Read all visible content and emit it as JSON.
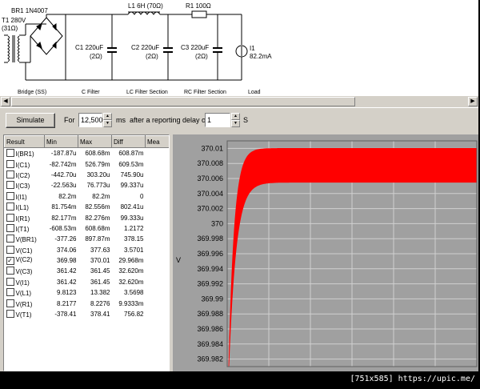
{
  "schematic": {
    "transformer_label": "T1 280V",
    "transformer_res": "(31Ω)",
    "bridge_label": "BR1 1N4007",
    "inductor_label": "L1 6H (70Ω)",
    "resistor_label": "R1 100Ω",
    "c1_label": "C1 220uF",
    "c1_res": "(2Ω)",
    "c2_label": "C2 220uF",
    "c2_res": "(2Ω)",
    "c3_label": "C3 220uF",
    "c3_res": "(2Ω)",
    "load_name": "I1",
    "load_value": "82.2mA",
    "sections": [
      "Bridge (SS)",
      "C Filter",
      "LC Filter Section",
      "RC Filter Section",
      "Load"
    ]
  },
  "toolbar": {
    "simulate_label": "Simulate",
    "for_label": "For",
    "duration_value": "12,500",
    "ms_label": "ms",
    "delay_label": "after a reporting delay of",
    "delay_value": "1",
    "s_label": "S"
  },
  "results": {
    "headers": [
      "Result",
      "Min",
      "Max",
      "Diff",
      "Mea"
    ],
    "rows": [
      {
        "name": "I(BR1)",
        "min": "-187.87u",
        "max": "608.68m",
        "diff": "608.87m",
        "mean": "41.102",
        "checked": false
      },
      {
        "name": "I(C1)",
        "min": "-82.742m",
        "max": "526.79m",
        "diff": "609.53m",
        "mean": "-2.118",
        "checked": false
      },
      {
        "name": "I(C2)",
        "min": "-442.70u",
        "max": "303.20u",
        "diff": "745.90u",
        "mean": "382.74",
        "checked": false
      },
      {
        "name": "I(C3)",
        "min": "-22.563u",
        "max": "76.773u",
        "diff": "99.337u",
        "mean": "468.07",
        "checked": false
      },
      {
        "name": "I(I1)",
        "min": "82.2m",
        "max": "82.2m",
        "diff": "0",
        "mean": "82.200",
        "checked": false
      },
      {
        "name": "I(L1)",
        "min": "81.754m",
        "max": "82.556m",
        "diff": "802.41u",
        "mean": "82.200",
        "checked": false
      },
      {
        "name": "I(R1)",
        "min": "82.177m",
        "max": "82.276m",
        "diff": "99.333u",
        "mean": "82.200",
        "checked": false
      },
      {
        "name": "I(T1)",
        "min": "-608.53m",
        "max": "608.68m",
        "diff": "1.2172",
        "mean": "101.49",
        "checked": false
      },
      {
        "name": "V(BR1)",
        "min": "-377.26",
        "max": "897.87m",
        "diff": "378.15",
        "mean": "-250.9",
        "checked": false
      },
      {
        "name": "V(C1)",
        "min": "374.06",
        "max": "377.63",
        "diff": "3.5701",
        "mean": "375.7",
        "checked": false
      },
      {
        "name": "V(C2)",
        "min": "369.98",
        "max": "370.01",
        "diff": "29.968m",
        "mean": "370.0",
        "checked": true
      },
      {
        "name": "V(C3)",
        "min": "361.42",
        "max": "361.45",
        "diff": "32.620m",
        "mean": "361.4",
        "checked": false
      },
      {
        "name": "V(I1)",
        "min": "361.42",
        "max": "361.45",
        "diff": "32.620m",
        "mean": "361.4",
        "checked": false
      },
      {
        "name": "V(L1)",
        "min": "9.8123",
        "max": "13.382",
        "diff": "3.5698",
        "mean": "11.50",
        "checked": false
      },
      {
        "name": "V(R1)",
        "min": "8.2177",
        "max": "8.2276",
        "diff": "9.9333m",
        "mean": "8.220",
        "checked": false
      },
      {
        "name": "V(T1)",
        "min": "-378.41",
        "max": "378.41",
        "diff": "756.82",
        "mean": "1.9515",
        "checked": false
      }
    ]
  },
  "chart_data": {
    "type": "area",
    "series": [
      {
        "name": "V(C2)",
        "color": "#ff0000"
      }
    ],
    "ylabel": "V",
    "ylim": [
      369.981,
      370.011
    ],
    "ytick_labels": [
      "370.01",
      "370.008",
      "370.006",
      "370.004",
      "370.002",
      "370",
      "369.998",
      "369.996",
      "369.994",
      "369.992",
      "369.99",
      "369.988",
      "369.986",
      "369.984",
      "369.982"
    ],
    "ytick_values": [
      370.01,
      370.008,
      370.006,
      370.004,
      370.002,
      370.0,
      369.998,
      369.996,
      369.994,
      369.992,
      369.99,
      369.988,
      369.986,
      369.984,
      369.982
    ],
    "envelope_steady_min": 370.0055,
    "envelope_steady_max": 370.01,
    "grid": true,
    "background": "#a0a0a0",
    "grid_color": "#d0d0d0"
  },
  "status": {
    "text": "[751x585] https://upic.me/"
  }
}
